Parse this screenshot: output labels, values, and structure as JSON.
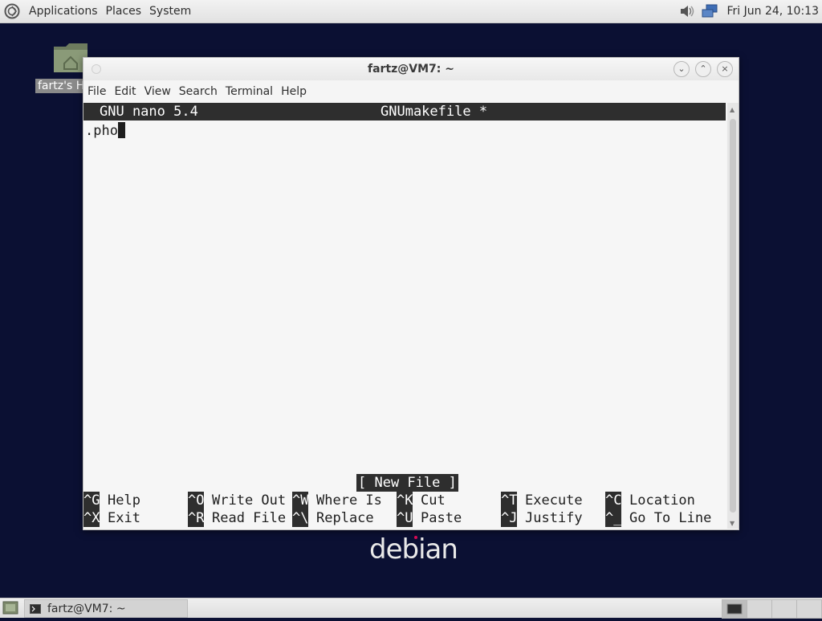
{
  "top_panel": {
    "menus": [
      "Applications",
      "Places",
      "System"
    ],
    "clock": "Fri Jun 24, 10:13"
  },
  "desktop": {
    "home_icon_label": "fartz's Home"
  },
  "window": {
    "title": "fartz@VM7: ~",
    "menu": [
      "File",
      "Edit",
      "View",
      "Search",
      "Terminal",
      "Help"
    ]
  },
  "nano": {
    "version": "GNU nano 5.4",
    "filename": "GNUmakefile *",
    "content_line": ".pho",
    "status": "[ New File ]",
    "shortcuts": [
      {
        "key": "^G",
        "label": "Help"
      },
      {
        "key": "^O",
        "label": "Write Out"
      },
      {
        "key": "^W",
        "label": "Where Is"
      },
      {
        "key": "^K",
        "label": "Cut"
      },
      {
        "key": "^T",
        "label": "Execute"
      },
      {
        "key": "^C",
        "label": "Location"
      },
      {
        "key": "^X",
        "label": "Exit"
      },
      {
        "key": "^R",
        "label": "Read File"
      },
      {
        "key": "^\\",
        "label": "Replace"
      },
      {
        "key": "^U",
        "label": "Paste"
      },
      {
        "key": "^J",
        "label": "Justify"
      },
      {
        "key": "^_",
        "label": "Go To Line"
      }
    ]
  },
  "wallpaper_text": "debian",
  "taskbar": {
    "task_label": "fartz@VM7: ~"
  },
  "colors": {
    "desktop_bg": "#0b1033",
    "terminal_bg": "#f6f6f6",
    "nano_bar": "#2e2e2e",
    "debian_dot": "#d70a53"
  }
}
